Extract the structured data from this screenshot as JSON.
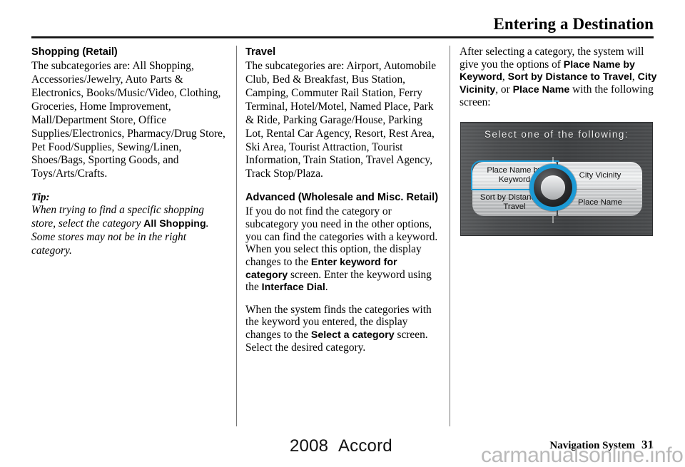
{
  "header": {
    "title": "Entering a Destination"
  },
  "columns": {
    "col1": {
      "shopping_heading": "Shopping (Retail)",
      "shopping_body": "The subcategories are: All Shopping, Accessories/Jewelry, Auto Parts & Electronics, Books/Music/Video, Clothing, Groceries, Home Improvement, Mall/Department Store, Office Supplies/Electronics, Pharmacy/Drug Store, Pet Food/Supplies, Sewing/Linen, Shoes/Bags, Sporting Goods, and Toys/Arts/Crafts.",
      "tip_label": "Tip:",
      "tip_part1": "When trying to find a specific shopping store, select the category ",
      "tip_ui1": "All Shopping",
      "tip_part2": ". Some stores may not be in the right category."
    },
    "col2": {
      "travel_heading": "Travel",
      "travel_body": "The subcategories are: Airport, Automobile Club, Bed & Breakfast, Bus Station, Camping, Commuter Rail Station, Ferry Terminal, Hotel/Motel, Named Place, Park & Ride, Parking Garage/House, Parking Lot, Rental Car Agency, Resort, Rest Area, Ski Area, Tourist Attraction, Tourist Information, Train Station, Travel Agency, Track Stop/Plaza.",
      "advanced_heading": "Advanced (Wholesale and Misc. Retail)",
      "advanced_part1": "If you do not find the category or subcategory you need in the other options, you can find the categories with a keyword. When you select this option, the display changes to the ",
      "advanced_ui1": "Enter keyword for category",
      "advanced_part2": " screen. Enter the keyword using the ",
      "advanced_ui2": "Interface Dial",
      "advanced_part3": ".",
      "found_part1": "When the system finds the categories with the keyword you entered, the display changes to the ",
      "found_ui1": "Select a category",
      "found_part2": " screen. Select the desired category."
    },
    "col3": {
      "intro_part1": "After selecting a category, the system will give you the options of ",
      "intro_ui1": "Place Name by Keyword",
      "intro_sep1": ", ",
      "intro_ui2": "Sort by Distance to Travel",
      "intro_sep2": ", ",
      "intro_ui3": "City Vicinity",
      "intro_sep3": ", or ",
      "intro_ui4": "Place Name",
      "intro_part2": " with the following screen:"
    }
  },
  "nav_screen": {
    "title": "Select one of the following:",
    "buttons": {
      "left_top": "Place Name by Keyword",
      "left_bottom": "Sort by Distance to Travel",
      "right_top": "City Vicinity",
      "right_bottom": "Place Name"
    },
    "highlight_color": "#1c9ad6",
    "dial_ring_color": "#1c9ad6",
    "background_color": "#4a4c4e"
  },
  "footer": {
    "model_year": "2008",
    "model_name": "Accord",
    "section": "Navigation System",
    "page_number": "31",
    "watermark": "carmanualsonline.info"
  }
}
